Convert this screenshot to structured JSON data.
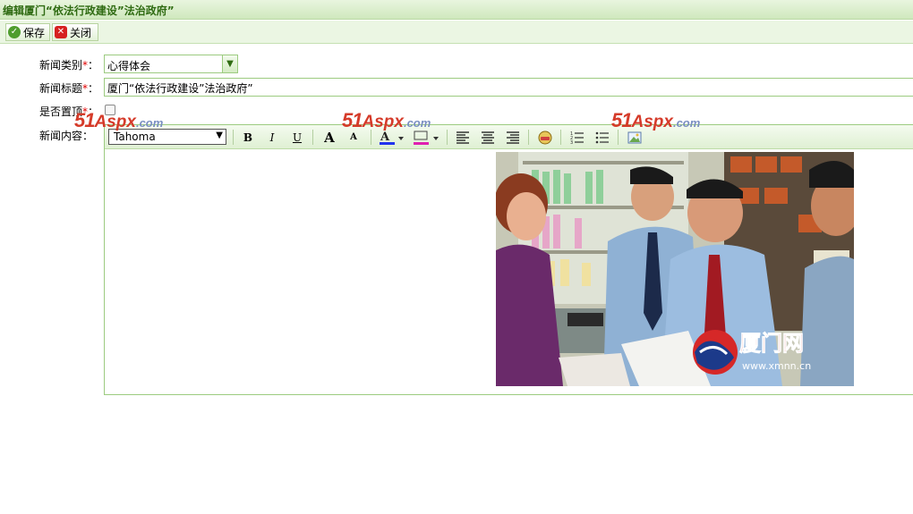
{
  "window": {
    "title": "编辑厦门“依法行政建设”法治政府”"
  },
  "toolbar": {
    "save_label": "保存",
    "close_label": "关闭"
  },
  "form": {
    "category_label": "新闻类别",
    "category_value": "心得体会",
    "title_label": "新闻标题",
    "title_value": "厦门“依法行政建设”法治政府”",
    "pin_label": "是否置顶",
    "content_label": "新闻内容",
    "required_mark": "*",
    "colon": "："
  },
  "editor": {
    "font_value": "Tahoma",
    "buttons": [
      "B",
      "I",
      "U",
      "A",
      "A"
    ],
    "photo_caption": "厦门网",
    "photo_url": "www.xmnn.cn"
  },
  "watermark": {
    "text_big": "51",
    "text_main": "Aspx",
    "text_dom": ".com"
  },
  "colors": {
    "accent": "#2f6b12",
    "border": "#9ccb80",
    "required": "#e00000"
  }
}
